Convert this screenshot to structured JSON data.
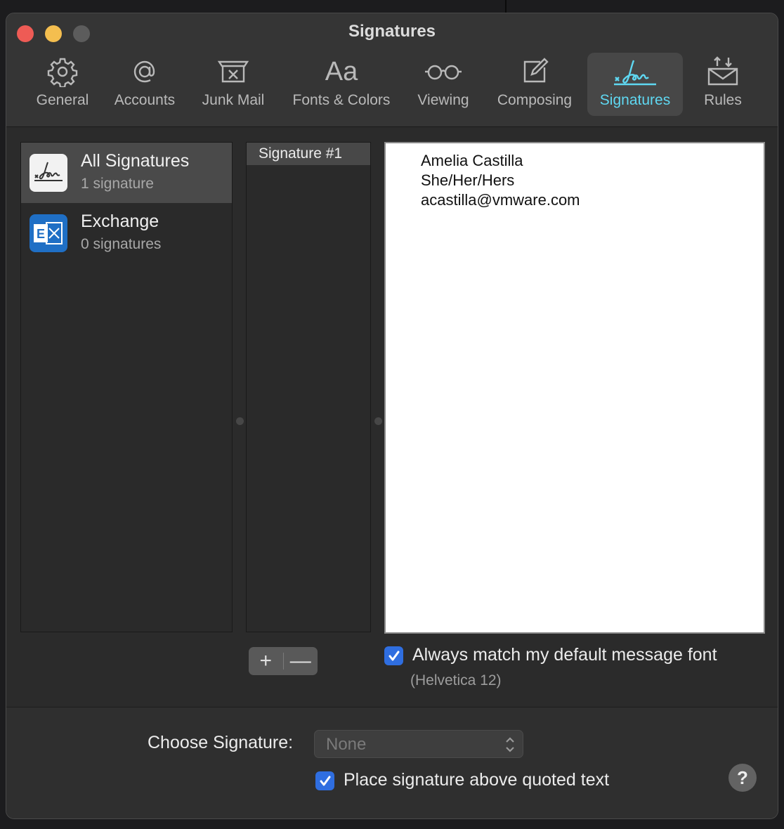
{
  "window": {
    "title": "Signatures"
  },
  "toolbar": {
    "items": [
      {
        "label": "General",
        "icon": "gear-icon"
      },
      {
        "label": "Accounts",
        "icon": "at-sign-icon"
      },
      {
        "label": "Junk Mail",
        "icon": "junk-mail-icon"
      },
      {
        "label": "Fonts & Colors",
        "icon": "text-aa-icon"
      },
      {
        "label": "Viewing",
        "icon": "glasses-icon"
      },
      {
        "label": "Composing",
        "icon": "compose-icon"
      },
      {
        "label": "Signatures",
        "icon": "signature-icon",
        "active": true
      },
      {
        "label": "Rules",
        "icon": "rules-envelope-icon"
      }
    ]
  },
  "accounts": [
    {
      "name": "All Signatures",
      "count": "1 signature",
      "icon": "signature-icon",
      "selected": true
    },
    {
      "name": "Exchange",
      "count": "0 signatures",
      "icon": "exchange-icon"
    }
  ],
  "signatures": [
    {
      "name": "Signature #1",
      "selected": true
    }
  ],
  "editor": {
    "lines": [
      "Amelia Castilla",
      "She/Her/Hers",
      "acastilla@vmware.com"
    ]
  },
  "buttons": {
    "add": "+",
    "remove": "—"
  },
  "match_font": {
    "label": "Always match my default message font",
    "note": "(Helvetica 12)",
    "checked": true
  },
  "choose_signature": {
    "label": "Choose Signature:",
    "value": "None"
  },
  "place_above": {
    "label": "Place signature above quoted text",
    "checked": true
  },
  "help": {
    "label": "?"
  },
  "colors": {
    "accent": "#5fd8f2",
    "checkbox": "#2f6ee0",
    "exchange": "#1f6fc5"
  }
}
